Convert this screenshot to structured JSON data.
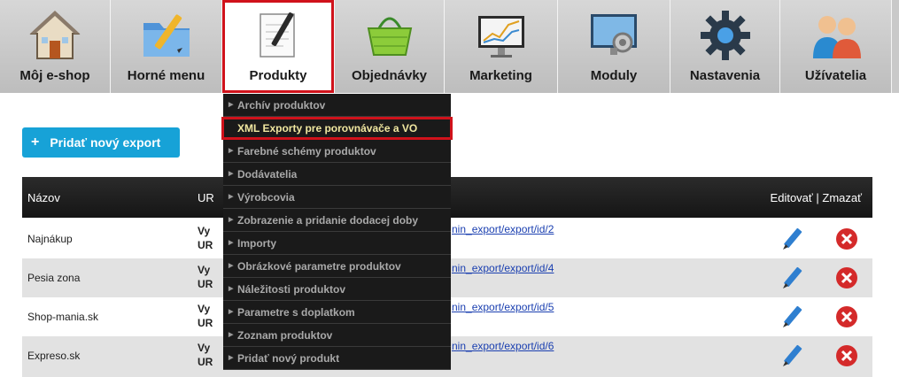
{
  "nav": {
    "items": [
      {
        "label": "Môj e-shop",
        "icon": "home-icon"
      },
      {
        "label": "Horné menu",
        "icon": "folder-pen-icon"
      },
      {
        "label": "Produkty",
        "icon": "notepad-pen-icon"
      },
      {
        "label": "Objednávky",
        "icon": "basket-icon"
      },
      {
        "label": "Marketing",
        "icon": "chart-monitor-icon"
      },
      {
        "label": "Moduly",
        "icon": "monitor-gear-icon"
      },
      {
        "label": "Nastavenia",
        "icon": "gear-icon"
      },
      {
        "label": "Užívatelia",
        "icon": "users-icon"
      }
    ],
    "active_index": 2
  },
  "add_button": {
    "plus": "+",
    "label": "Pridať nový export"
  },
  "table": {
    "headers": {
      "name": "Názov",
      "url": "UR",
      "actions": "Editovať | Zmazať"
    },
    "rows": [
      {
        "name": "Najnákup",
        "vy": "Vy",
        "ur": "UR",
        "link": "nin_export/export/id/2"
      },
      {
        "name": "Pesia zona",
        "vy": "Vy",
        "ur": "UR",
        "link": "nin_export/export/id/4"
      },
      {
        "name": "Shop-mania.sk",
        "vy": "Vy",
        "ur": "UR",
        "link": "nin_export/export/id/5"
      },
      {
        "name": "Expreso.sk",
        "vy": "Vy",
        "ur": "UR",
        "link": "nin_export/export/id/6"
      }
    ]
  },
  "dropdown": {
    "items": [
      "Archív produktov",
      "XML Exporty pre porovnávače a VO",
      "Farebné schémy produktov",
      "Dodávatelia",
      "Výrobcovia",
      "Zobrazenie a pridanie dodacej doby",
      "Importy",
      "Obrázkové parametre produktov",
      "Náležitosti produktov",
      "Parametre s doplatkom",
      "Zoznam produktov",
      "Pridať nový produkt"
    ],
    "highlighted_index": 1
  },
  "colors": {
    "accent": "#17a2d7",
    "highlight_border": "#d0121b",
    "menu_bg": "#1a1a1a",
    "header_bg": "#1e1e1e"
  }
}
